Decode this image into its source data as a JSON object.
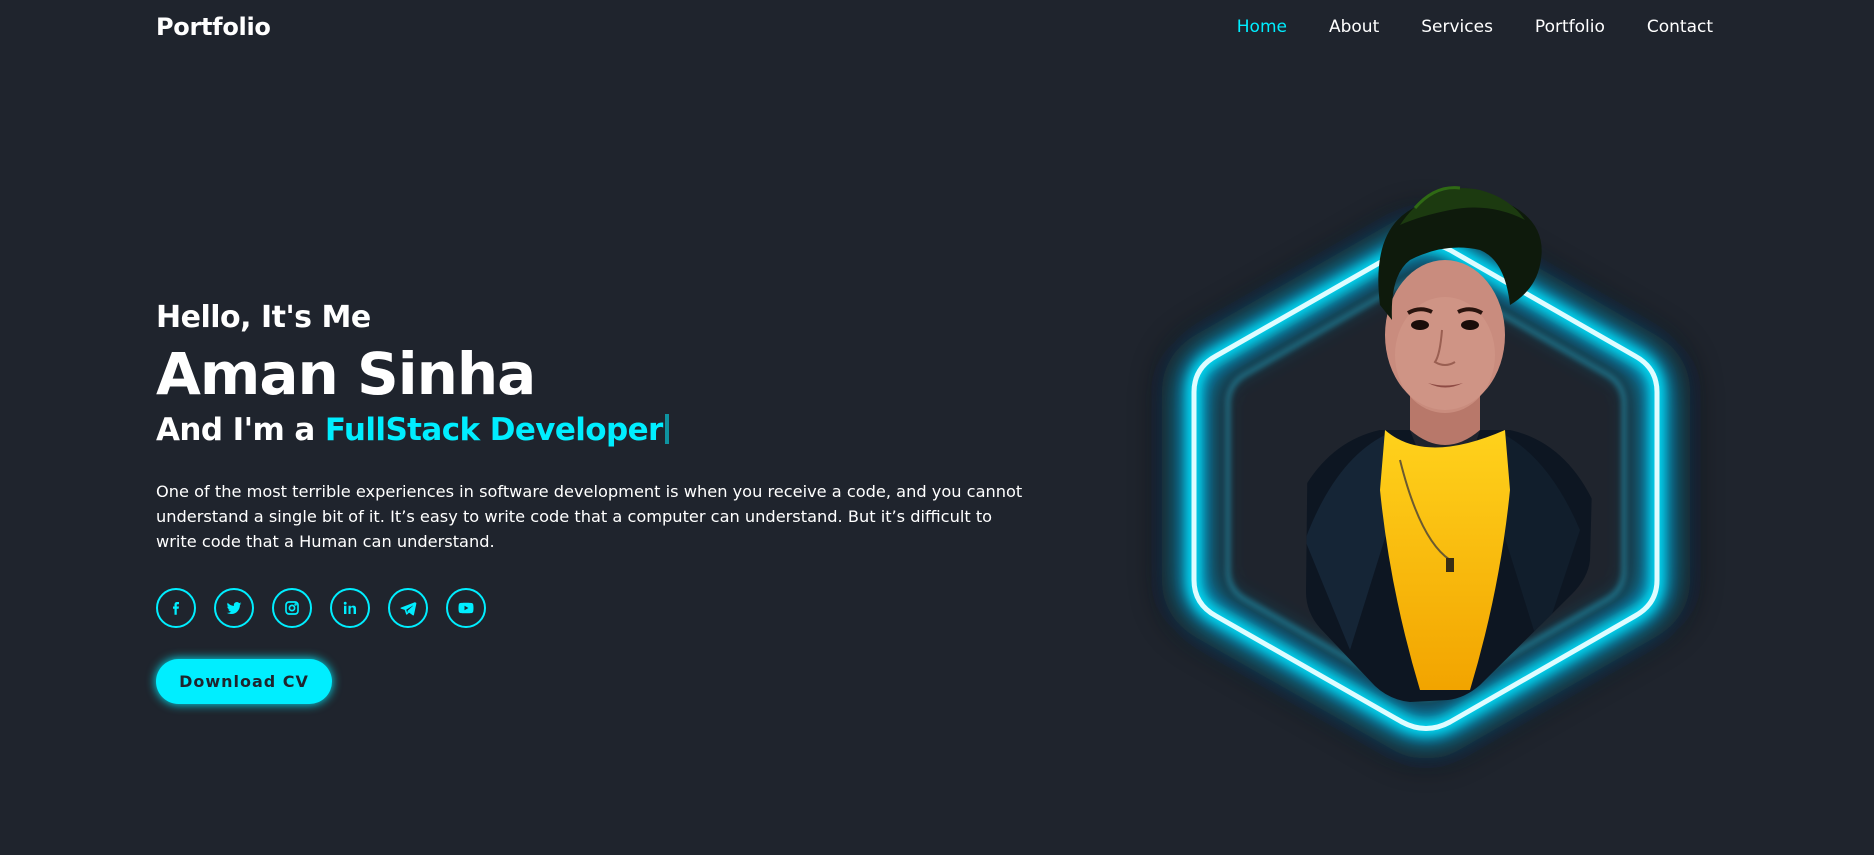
{
  "header": {
    "logo": "Portfolio",
    "nav": [
      "Home",
      "About",
      "Services",
      "Portfolio",
      "Contact"
    ],
    "active": "Home"
  },
  "hero": {
    "greeting": "Hello, It's Me",
    "name": "Aman Sinha",
    "role_prefix": "And I'm a",
    "role_accent": "FullStack Developer",
    "description": "One of the most terrible experiences in software development is when you receive a code, and you cannot understand a single bit of it. It’s easy to write code that a computer can understand. But it’s difficult to write code that a Human can understand.",
    "socials": [
      "facebook-icon",
      "twitter-icon",
      "instagram-icon",
      "linkedin-icon",
      "telegram-icon",
      "youtube-icon"
    ],
    "button": "Download CV"
  },
  "colors": {
    "background": "#1f242d",
    "accent": "#00eeff",
    "text": "#ffffff"
  }
}
